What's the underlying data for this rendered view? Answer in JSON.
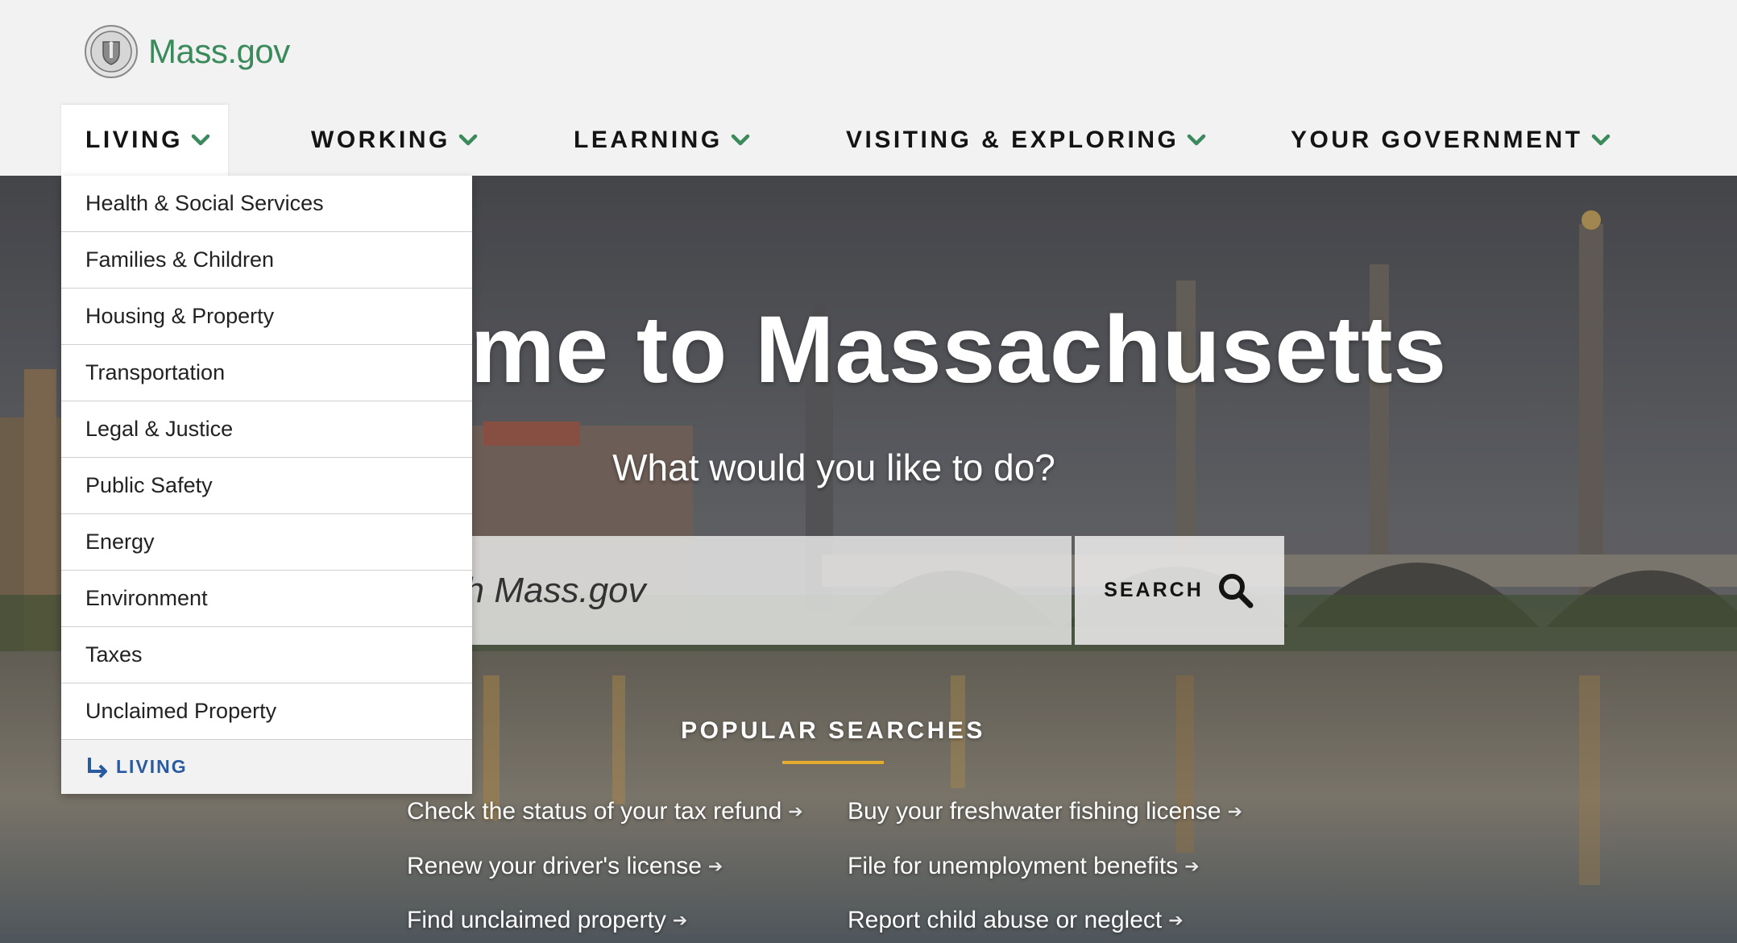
{
  "brand": {
    "name": "Mass.gov",
    "seal_icon": "state-seal-icon",
    "color": "#3a8a5c"
  },
  "nav": {
    "items": [
      {
        "label": "LIVING",
        "active": true
      },
      {
        "label": "WORKING",
        "active": false
      },
      {
        "label": "LEARNING",
        "active": false
      },
      {
        "label": "VISITING & EXPLORING",
        "active": false
      },
      {
        "label": "YOUR GOVERNMENT",
        "active": false
      }
    ],
    "chevron_icon": "chevron-down-icon",
    "chevron_color": "#3a8a5c"
  },
  "dropdown": {
    "items": [
      "Health & Social Services",
      "Families & Children",
      "Housing & Property",
      "Transportation",
      "Legal & Justice",
      "Public Safety",
      "Energy",
      "Environment",
      "Taxes",
      "Unclaimed Property"
    ],
    "footer_label": "LIVING",
    "footer_icon": "arrow-return-right-icon",
    "footer_color": "#2a5ba0"
  },
  "hero": {
    "title": "come to Massachusetts",
    "subtitle": "What would you like to do?",
    "search_placeholder": "rch Mass.gov",
    "search_button": "SEARCH",
    "search_icon": "search-icon"
  },
  "popular": {
    "title": "POPULAR SEARCHES",
    "accent_color": "#e4ab2c",
    "links": [
      "Check the status of your tax refund",
      "Buy your freshwater fishing license",
      "Renew your driver's license",
      "File for unemployment benefits",
      "Find unclaimed property",
      "Report child abuse or neglect"
    ],
    "arrow_icon": "arrow-right-icon"
  }
}
